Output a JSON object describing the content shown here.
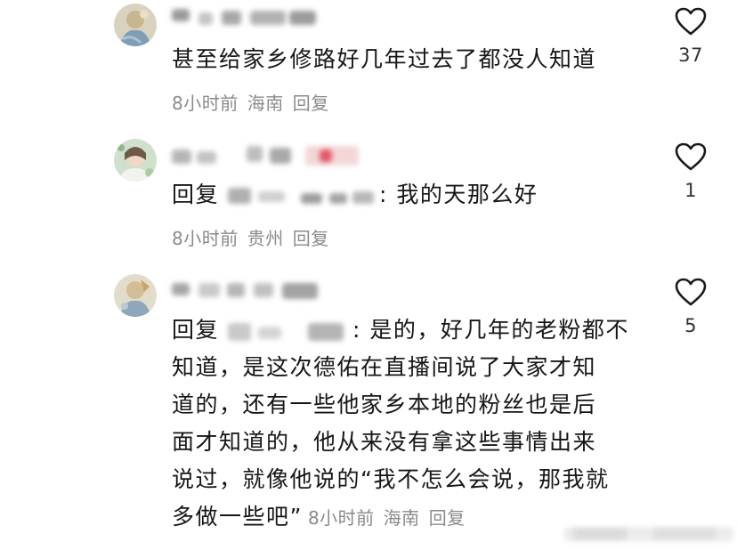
{
  "comments": [
    {
      "text": "甚至给家乡修路好几年过去了都没人知道",
      "time": "8小时前",
      "location": "海南",
      "reply_label": "回复",
      "likes": "37"
    },
    {
      "reply_prefix": "回复",
      "text": ": 我的天那么好",
      "time": "8小时前",
      "location": "贵州",
      "reply_label": "回复",
      "likes": "1"
    },
    {
      "reply_prefix": "回复",
      "text_line1": ": 是的，好几年的老粉都不",
      "text_lines": [
        "知道，是这次德佑在直播间说了大家才知",
        "道的，还有一些他家乡本地的粉丝也是后",
        "面才知道的，他从来没有拿这些事情出来",
        "说过，就像他说的“我不怎么会说，那我就"
      ],
      "text_last": "多做一些吧”",
      "time": "8小时前",
      "location": "海南",
      "reply_label": "回复",
      "likes": "5"
    }
  ],
  "icons": {
    "like": "heart-outline-icon"
  },
  "colors": {
    "meta_gray": "#8a8a8a",
    "text": "#161616",
    "heart_stroke": "#1a1a1a"
  }
}
